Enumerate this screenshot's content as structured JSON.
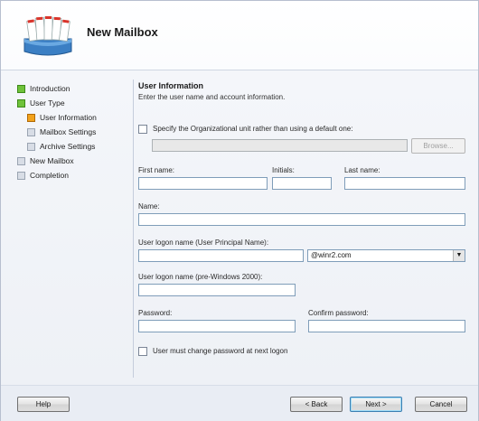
{
  "header": {
    "title": "New Mailbox",
    "icon": "mailbox-icon"
  },
  "nav": {
    "items": [
      {
        "label": "Introduction",
        "status": "completed",
        "color": "#6fc23a"
      },
      {
        "label": "User Type",
        "status": "completed",
        "color": "#6fc23a"
      },
      {
        "label": "User Information",
        "status": "current",
        "color": "#f2a21c"
      },
      {
        "label": "Mailbox Settings",
        "status": "pending"
      },
      {
        "label": "Archive Settings",
        "status": "pending"
      },
      {
        "label": "New Mailbox",
        "status": "pending"
      },
      {
        "label": "Completion",
        "status": "pending"
      }
    ]
  },
  "main": {
    "title": "User Information",
    "subtitle": "Enter the user name and account information.",
    "ou_checkbox_label": "Specify the Organizational unit rather than using a default one:",
    "ou_value": "",
    "browse_label": "Browse...",
    "first_name_label": "First name:",
    "first_name_value": "",
    "initials_label": "Initials:",
    "initials_value": "",
    "last_name_label": "Last name:",
    "last_name_value": "",
    "name_label": "Name:",
    "name_value": "",
    "upn_label": "User logon name (User Principal Name):",
    "upn_value": "",
    "domain_value": "@winr2.com",
    "pre2000_label": "User logon name (pre-Windows 2000):",
    "pre2000_value": "",
    "password_label": "Password:",
    "password_value": "",
    "confirm_password_label": "Confirm password:",
    "confirm_password_value": "",
    "change_password_label": "User must change password at next logon"
  },
  "footer": {
    "help_label": "Help",
    "back_label": "< Back",
    "next_label": "Next >",
    "cancel_label": "Cancel"
  }
}
